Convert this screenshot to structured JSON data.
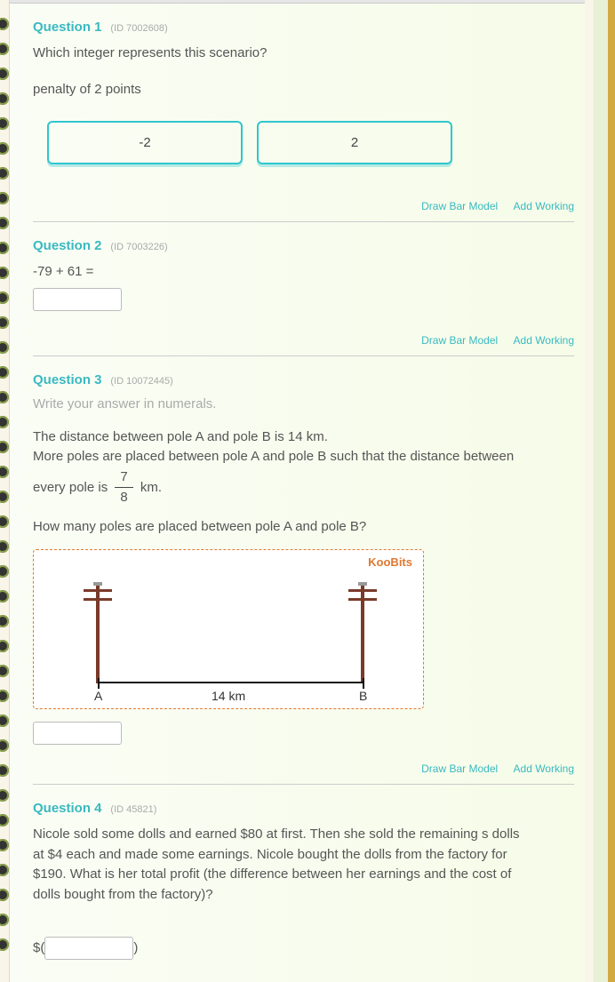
{
  "colors": {
    "accent": "#39b9c1",
    "image_accent": "#e07830"
  },
  "links": {
    "draw": "Draw Bar Model",
    "add": "Add Working"
  },
  "q1": {
    "title": "Question 1",
    "id": "(ID 7002608)",
    "prompt": "Which integer represents this scenario?",
    "scenario": "penalty of 2 points",
    "choices": [
      "-2",
      "2"
    ]
  },
  "q2": {
    "title": "Question 2",
    "id": "(ID 7003226)",
    "prompt": "-79 + 61 ="
  },
  "q3": {
    "title": "Question 3",
    "id": "(ID 10072445)",
    "hint": "Write your answer in numerals.",
    "line1": "The distance between pole A and pole B is 14 km.",
    "line2_a": "More poles are placed between pole A and pole B such that the distance between",
    "line2_b_pre": "every pole is ",
    "frac_num": "7",
    "frac_den": "8",
    "line2_b_post": " km.",
    "line3": "How many poles are placed between pole A and pole B?",
    "diagram": {
      "brand": "KooBits",
      "labelA": "A",
      "labelB": "B",
      "dist": "14 km"
    }
  },
  "q4": {
    "title": "Question 4",
    "id": "(ID 45821)",
    "body": "Nicole sold some dolls and earned $80 at first. Then she sold the remaining s dolls at $4 each and made some earnings. Nicole bought the dolls from the factory for $190. What is her total profit (the difference between her earnings and the cost of dolls bought from the factory)?",
    "answer_prefix": "$(",
    "answer_suffix": ")"
  }
}
